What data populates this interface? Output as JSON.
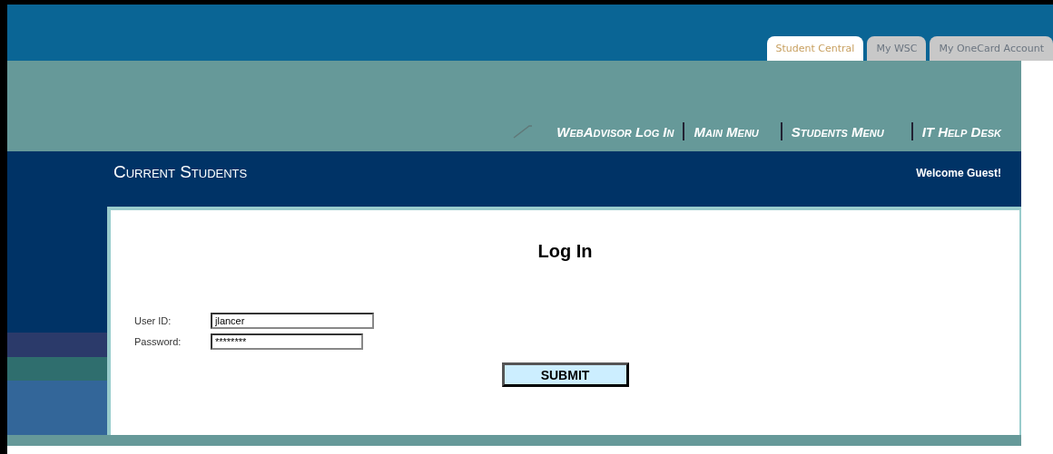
{
  "tabs": [
    {
      "label": "Student Central",
      "selected": true
    },
    {
      "label": "My WSC",
      "selected": false
    },
    {
      "label": "My OneCard Account",
      "selected": false
    }
  ],
  "nav": [
    "WebAdvisor Log In",
    "Main Menu",
    "Students Menu",
    "IT Help Desk"
  ],
  "section_title": "Current Students",
  "welcome": "Welcome Guest!",
  "login": {
    "title": "Log In",
    "fields": [
      {
        "label": "User ID:",
        "value": "jlancer"
      },
      {
        "label": "Password:",
        "value": "********"
      }
    ],
    "submit": "SUBMIT"
  }
}
